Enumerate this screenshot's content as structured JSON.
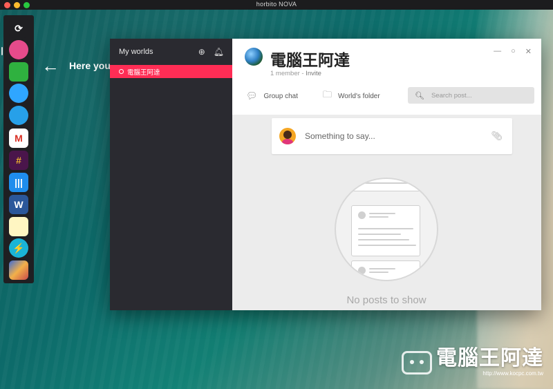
{
  "app": {
    "title": "horbito NOVA"
  },
  "colors": {
    "accent": "#ff2d55",
    "sidebar_bg": "#2a2a30",
    "dock_bg": "#1f1f22"
  },
  "dock": {
    "items": [
      {
        "name": "horbito-logo-icon",
        "glyph": "⟳",
        "bg": "#1f1f22",
        "color": "#ffffff"
      },
      {
        "name": "planet-icon",
        "glyph": "",
        "bg": "#e64b8b",
        "color": "#ffffff"
      },
      {
        "name": "folder-icon",
        "glyph": "",
        "bg": "#2fb13f",
        "color": "#ffffff"
      },
      {
        "name": "chat-bubbles-icon",
        "glyph": "",
        "bg": "#2fa6ff",
        "color": "#ffffff"
      },
      {
        "name": "store-bag-icon",
        "glyph": "",
        "bg": "#27a0e9",
        "color": "#ffffff"
      },
      {
        "name": "gmail-icon",
        "glyph": "M",
        "bg": "#ffffff",
        "color": "#d93025"
      },
      {
        "name": "slack-icon",
        "glyph": "#",
        "bg": "#4a154b",
        "color": "#ecb22e"
      },
      {
        "name": "intercom-icon",
        "glyph": "|||",
        "bg": "#1f8ded",
        "color": "#ffffff"
      },
      {
        "name": "word-icon",
        "glyph": "W",
        "bg": "#2b579a",
        "color": "#ffffff"
      },
      {
        "name": "notes-icon",
        "glyph": "",
        "bg": "#fff6c2",
        "color": "#333333"
      },
      {
        "name": "bolt-icon",
        "glyph": "⚡",
        "bg": "#1ab4d6",
        "color": "#ffffff"
      },
      {
        "name": "game-art-icon",
        "glyph": "",
        "bg": "#3d6bd6",
        "color": "#ffffff"
      }
    ]
  },
  "hint": {
    "text": "Here you"
  },
  "sidebar": {
    "title": "My worlds",
    "worlds": [
      {
        "label": "電腦王阿達"
      }
    ]
  },
  "world": {
    "title": "電腦王阿達",
    "members": "1 member",
    "separator": "-",
    "invite": "Invite"
  },
  "tabs": {
    "group_chat": "Group chat",
    "folder": "World's folder"
  },
  "search": {
    "placeholder": "Search post..."
  },
  "composer": {
    "placeholder": "Something to say..."
  },
  "empty": {
    "text": "No posts to show"
  },
  "watermark": {
    "name": "電腦王阿達",
    "url": "http://www.kocpc.com.tw"
  }
}
